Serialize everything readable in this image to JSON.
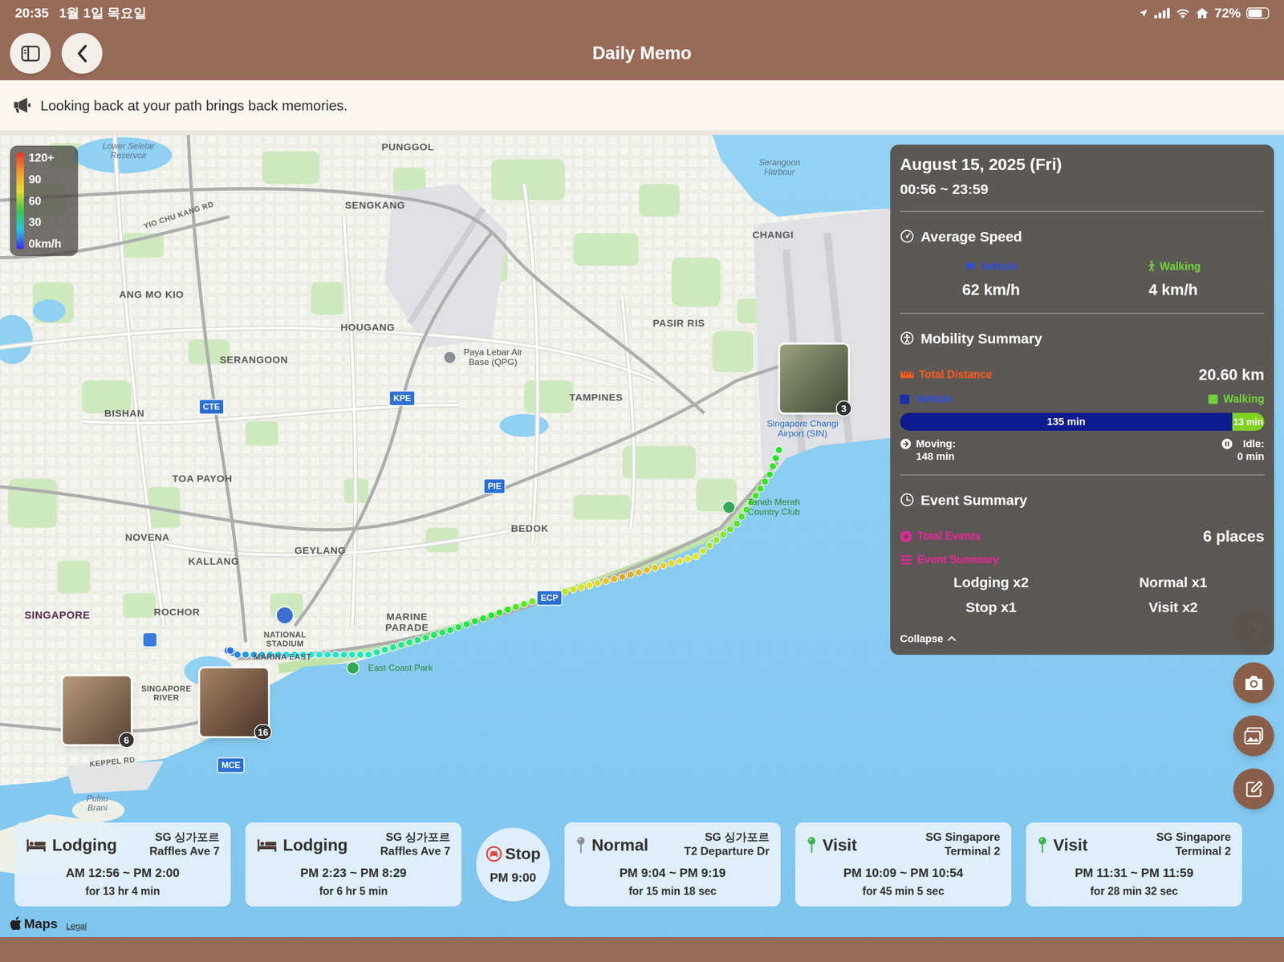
{
  "status_bar": {
    "time": "20:35",
    "date": "1월 1일 목요일",
    "battery": "72%",
    "battery_level": 0.72
  },
  "header": {
    "title": "Daily Memo"
  },
  "banner": {
    "text": "Looking back at your path brings back memories."
  },
  "legend": {
    "ticks": [
      "120+",
      "90",
      "60",
      "30",
      "0km/h"
    ]
  },
  "map": {
    "labels": [
      {
        "text": "Lower Seletar Reservoir",
        "kind": "water"
      },
      {
        "text": "PUNGGOL",
        "kind": "area"
      },
      {
        "text": "SENGKANG",
        "kind": "area"
      },
      {
        "text": "YIO CHU KANG RD",
        "kind": "road"
      },
      {
        "text": "ANG MO KIO",
        "kind": "area"
      },
      {
        "text": "SERANGOON",
        "kind": "area"
      },
      {
        "text": "HOUGANG",
        "kind": "area"
      },
      {
        "text": "BISHAN",
        "kind": "area"
      },
      {
        "text": "TOA PAYOH",
        "kind": "area"
      },
      {
        "text": "NOVENA",
        "kind": "area"
      },
      {
        "text": "KALLANG",
        "kind": "area"
      },
      {
        "text": "GEYLANG",
        "kind": "area"
      },
      {
        "text": "SINGAPORE",
        "kind": "city"
      },
      {
        "text": "ROCHOR",
        "kind": "area"
      },
      {
        "text": "MARINE PARADE",
        "kind": "area"
      },
      {
        "text": "BEDOK",
        "kind": "area"
      },
      {
        "text": "TAMPINES",
        "kind": "area"
      },
      {
        "text": "PASIR RIS",
        "kind": "area"
      },
      {
        "text": "CHANGI",
        "kind": "area"
      },
      {
        "text": "Serangoon Harbour",
        "kind": "water"
      },
      {
        "text": "Paya Lebar Air Base (QPG)",
        "kind": "poi"
      },
      {
        "text": "Singapore Changi Airport (SIN)",
        "kind": "airport"
      },
      {
        "text": "Tanah Merah Country Club",
        "kind": "park"
      },
      {
        "text": "East Coast Park",
        "kind": "park"
      },
      {
        "text": "NATIONAL STADIUM",
        "kind": "small"
      },
      {
        "text": "MARINA EAST",
        "kind": "small"
      },
      {
        "text": "SINGAPORE RIVER",
        "kind": "small"
      },
      {
        "text": "KEPPEL RD",
        "kind": "road"
      },
      {
        "text": "Pulau Brani",
        "kind": "water"
      }
    ],
    "highways": [
      "CTE",
      "KPE",
      "PIE",
      "ECP",
      "MCE"
    ],
    "photos": [
      {
        "count": "3"
      },
      {
        "count": "6"
      },
      {
        "count": "16"
      }
    ],
    "attribution": {
      "logo": "Maps",
      "legal": "Legal"
    }
  },
  "summary": {
    "date": "August 15, 2025 (Fri)",
    "range": "00:56 ~ 23:59",
    "average_speed": {
      "title": "Average Speed",
      "vehicle": {
        "label": "Vehicle",
        "value": "62 km/h"
      },
      "walking": {
        "label": "Walking",
        "value": "4 km/h"
      }
    },
    "mobility": {
      "title": "Mobility Summary",
      "total_label": "Total Distance",
      "total": "20.60 km",
      "vehicle_label": "Vehicle",
      "walking_label": "Walking",
      "vehicle_time": "135 min",
      "walking_time": "13 min",
      "vehicle_level": 0.912,
      "moving_label": "Moving:",
      "moving": "148 min",
      "idle_label": "Idle:",
      "idle": "0 min"
    },
    "events": {
      "title": "Event Summary",
      "total_label": "Total Events",
      "total": "6 places",
      "breakdown_label": "Event Summary",
      "counts": [
        "Lodging x2",
        "Normal x1",
        "Stop x1",
        "Visit x2"
      ]
    },
    "collapse": "Collapse"
  },
  "events": [
    {
      "kind": "lodging",
      "type": "Lodging",
      "color": "#4f3f38",
      "region": "SG 싱가포르",
      "place": "Raffles Ave 7",
      "time": "AM 12:56 ~ PM 2:00",
      "duration": "for 13 hr 4 min"
    },
    {
      "kind": "lodging",
      "type": "Lodging",
      "color": "#4f3f38",
      "region": "SG 싱가포르",
      "place": "Raffles Ave 7",
      "time": "PM 2:23 ~ PM 8:29",
      "duration": "for 6 hr 5 min"
    },
    {
      "kind": "stop",
      "type": "Stop",
      "color": "#e2473d",
      "time": "PM 9:00"
    },
    {
      "kind": "normal",
      "type": "Normal",
      "color": "#8e8e93",
      "region": "SG 싱가포르",
      "place": "T2 Departure Dr",
      "time": "PM 9:04 ~ PM 9:19",
      "duration": "for 15 min 18 sec"
    },
    {
      "kind": "visit",
      "type": "Visit",
      "color": "#3bb54a",
      "region": "SG Singapore",
      "place": "Terminal 2",
      "time": "PM 10:09 ~ PM 10:54",
      "duration": "for 45 min 5 sec"
    },
    {
      "kind": "visit",
      "type": "Visit",
      "color": "#3bb54a",
      "region": "SG Singapore",
      "place": "Terminal 2",
      "time": "PM 11:31 ~ PM 11:59",
      "duration": "for 28 min 32 sec"
    }
  ]
}
